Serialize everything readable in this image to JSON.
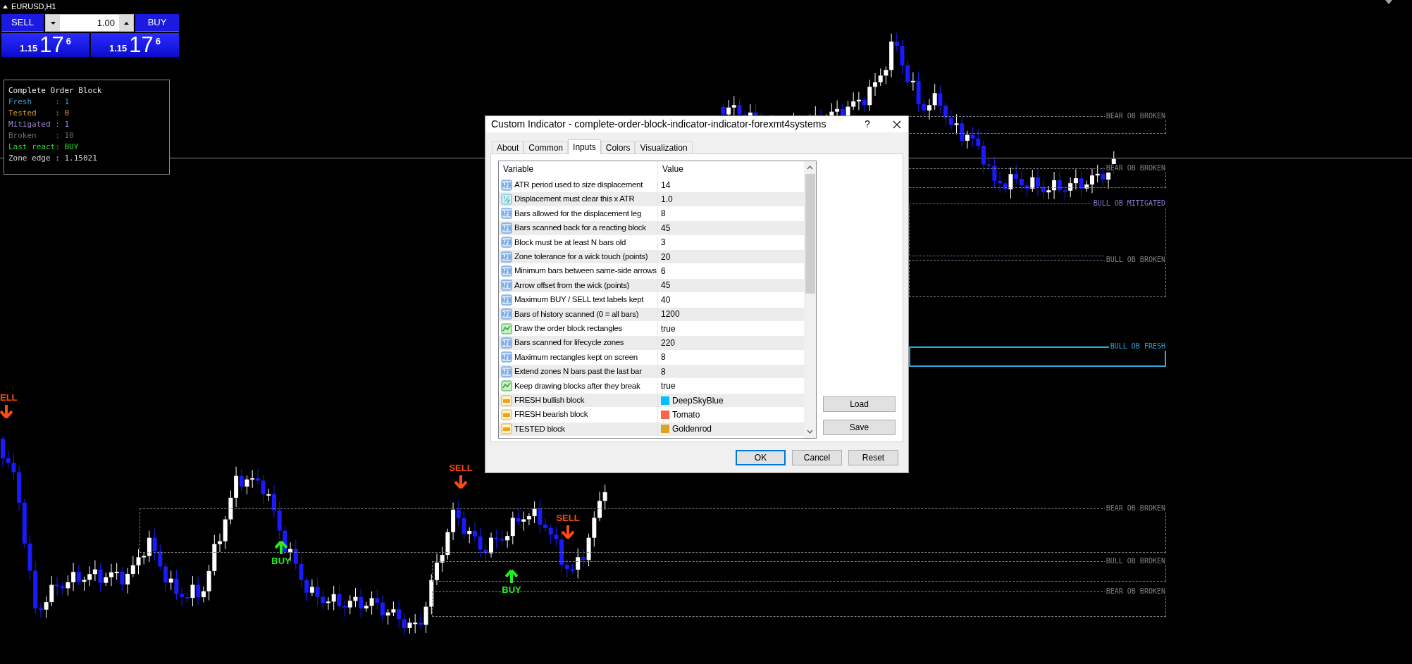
{
  "chart": {
    "symbol": "EURUSD,H1"
  },
  "trade_panel": {
    "sell_label": "SELL",
    "buy_label": "BUY",
    "lot": "1.00",
    "sell_price": {
      "prefix": "1.15",
      "big": "17",
      "small": "6"
    },
    "buy_price": {
      "prefix": "1.15",
      "big": "17",
      "small": "6"
    }
  },
  "info_box": {
    "title": "Complete Order Block",
    "lines": [
      {
        "text": "Fresh     : 1",
        "color": "#2fa3cc"
      },
      {
        "text": "Tested    : 0",
        "color": "#d49e3a"
      },
      {
        "text": "Mitigated : 1",
        "color": "#9a85c8"
      },
      {
        "text": "Broken    : 10",
        "color": "#6e6e6e"
      },
      {
        "text": "Last react: BUY",
        "color": "#22dd22"
      },
      {
        "text": "Zone edge : 1.15021",
        "color": "#d8d8d8"
      }
    ]
  },
  "zones": [
    {
      "label": "BEAR OB BROKEN",
      "kind": "broken",
      "color": "#808080"
    },
    {
      "label": "BEAR OB BROKEN",
      "kind": "broken",
      "color": "#808080"
    },
    {
      "label": "BULL OB MITIGATED",
      "kind": "mitigated",
      "color": "#8a7ad0"
    },
    {
      "label": "BULL OB BROKEN",
      "kind": "broken",
      "color": "#808080"
    },
    {
      "label": "BULL OB FRESH",
      "kind": "fresh",
      "color": "#2ba8d8"
    },
    {
      "label": "BEAR OB BROKEN",
      "kind": "broken",
      "color": "#808080"
    },
    {
      "label": "BULL OB BROKEN",
      "kind": "broken",
      "color": "#808080"
    },
    {
      "label": "BEAR OB BROKEN",
      "kind": "broken",
      "color": "#808080"
    }
  ],
  "signals": [
    {
      "kind": "sell",
      "label": "ELL"
    },
    {
      "kind": "buy",
      "label": "BUY"
    },
    {
      "kind": "sell",
      "label": "SELL"
    },
    {
      "kind": "buy",
      "label": "BUY"
    },
    {
      "kind": "sell",
      "label": "SELL"
    }
  ],
  "dialog": {
    "title": "Custom Indicator - complete-order-block-indicator-indicator-forexmt4systems",
    "help": "?",
    "tabs": [
      {
        "label": "About",
        "selected": false
      },
      {
        "label": "Common",
        "selected": false
      },
      {
        "label": "Inputs",
        "selected": true
      },
      {
        "label": "Colors",
        "selected": false
      },
      {
        "label": "Visualization",
        "selected": false
      }
    ],
    "columns": [
      "Variable",
      "Value"
    ],
    "rows": [
      {
        "kind": "int",
        "variable": "ATR period used to size displacement",
        "value": "14"
      },
      {
        "kind": "double",
        "variable": "Displacement must clear this x ATR",
        "value": "1.0"
      },
      {
        "kind": "int",
        "variable": "Bars allowed for the displacement leg",
        "value": "8"
      },
      {
        "kind": "int",
        "variable": "Bars scanned back for a reacting block",
        "value": "45"
      },
      {
        "kind": "int",
        "variable": "Block must be at least N bars old",
        "value": "3"
      },
      {
        "kind": "int",
        "variable": "Zone tolerance for a wick touch (points)",
        "value": "20"
      },
      {
        "kind": "int",
        "variable": "Minimum bars between same-side arrows",
        "value": "6"
      },
      {
        "kind": "int",
        "variable": "Arrow offset from the wick (points)",
        "value": "45"
      },
      {
        "kind": "int",
        "variable": "Maximum BUY / SELL text labels kept",
        "value": "40"
      },
      {
        "kind": "int",
        "variable": "Bars of history scanned (0 = all bars)",
        "value": "1200"
      },
      {
        "kind": "bool",
        "variable": "Draw the order block rectangles",
        "value": "true"
      },
      {
        "kind": "int",
        "variable": "Bars scanned for lifecycle zones",
        "value": "220"
      },
      {
        "kind": "int",
        "variable": "Maximum rectangles kept on screen",
        "value": "8"
      },
      {
        "kind": "int",
        "variable": "Extend zones N bars past the last bar",
        "value": "8"
      },
      {
        "kind": "bool",
        "variable": "Keep drawing blocks after they break",
        "value": "true"
      },
      {
        "kind": "color",
        "variable": "FRESH bullish block",
        "value": "DeepSkyBlue",
        "color": "#00bfff"
      },
      {
        "kind": "color",
        "variable": "FRESH bearish block",
        "value": "Tomato",
        "color": "#ff6347"
      },
      {
        "kind": "color",
        "variable": "TESTED block",
        "value": "Goldenrod",
        "color": "#daa520"
      }
    ],
    "side_buttons": [
      "Load",
      "Save"
    ],
    "buttons": [
      {
        "label": "OK",
        "default": true
      },
      {
        "label": "Cancel",
        "default": false
      },
      {
        "label": "Reset",
        "default": false
      }
    ]
  }
}
